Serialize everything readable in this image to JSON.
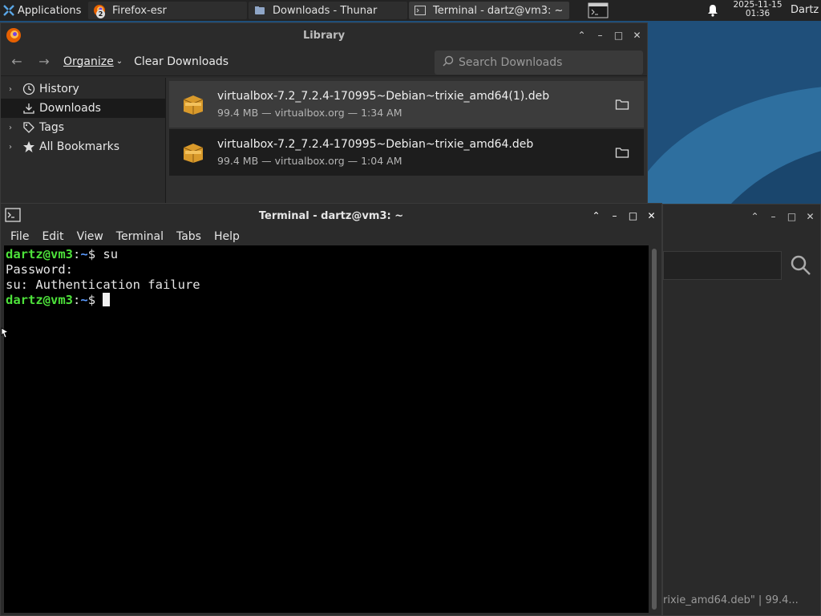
{
  "panel": {
    "applications_label": "Applications",
    "tasks": [
      {
        "label": "Firefox-esr",
        "badge": "2"
      },
      {
        "label": "Downloads - Thunar"
      },
      {
        "label": "Terminal - dartz@vm3: ~"
      }
    ],
    "clock_date": "2025-11-15",
    "clock_time": "01:36",
    "user": "Dartz"
  },
  "library": {
    "title": "Library",
    "organize_label": "Organize",
    "clear_downloads_label": "Clear Downloads",
    "search_placeholder": "Search Downloads",
    "sidebar": [
      {
        "label": "History",
        "icon": "clock-icon"
      },
      {
        "label": "Downloads",
        "icon": "download-icon",
        "selected": true
      },
      {
        "label": "Tags",
        "icon": "tag-icon"
      },
      {
        "label": "All Bookmarks",
        "icon": "star-icon"
      }
    ],
    "downloads": [
      {
        "name": "virtualbox-7.2_7.2.4-170995~Debian~trixie_amd64(1).deb",
        "meta": "99.4 MB — virtualbox.org — 1:34 AM"
      },
      {
        "name": "virtualbox-7.2_7.2.4-170995~Debian~trixie_amd64.deb",
        "meta": "99.4 MB — virtualbox.org — 1:04 AM"
      }
    ]
  },
  "terminal": {
    "title": "Terminal - dartz@vm3: ~",
    "menu": [
      "File",
      "Edit",
      "View",
      "Terminal",
      "Tabs",
      "Help"
    ],
    "lines": [
      {
        "user": "dartz@vm3",
        "path": "~",
        "cmd": "su"
      },
      {
        "text": "Password:"
      },
      {
        "text": "su: Authentication failure"
      },
      {
        "user": "dartz@vm3",
        "path": "~",
        "cmd": ""
      }
    ]
  },
  "thunar_bg": {
    "status_text": "rixie_amd64.deb\"  |  99.4..."
  },
  "colors": {
    "prompt_green": "#4de13a",
    "path_blue": "#5b9bff",
    "desktop_blue": "#1f4f7a"
  }
}
